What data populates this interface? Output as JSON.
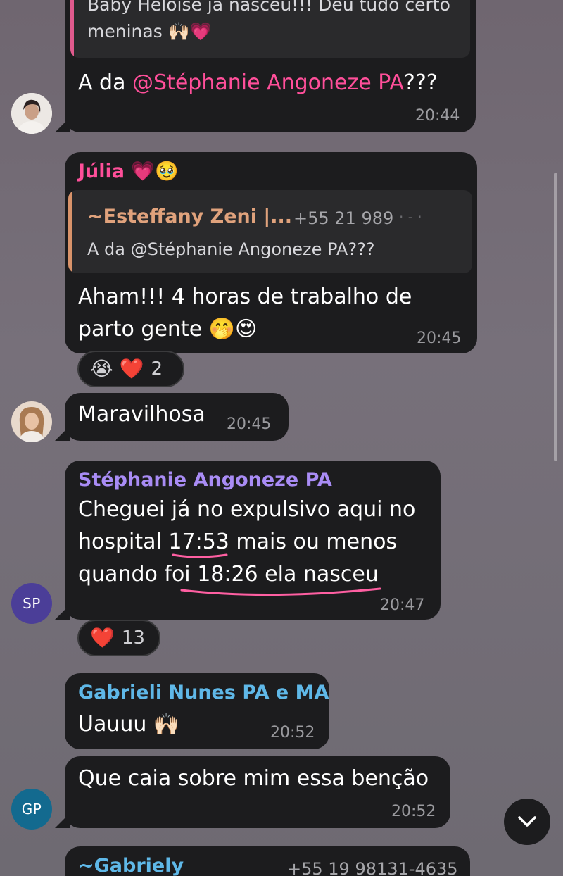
{
  "colors": {
    "bubble": "#1c1c1e",
    "julia": "#ff4f9a",
    "mention": "#ff4f9a",
    "stephanie": "#a98cf5",
    "gabrieli": "#5fb8e8",
    "gabriely": "#5fb8e8",
    "quote_bar_orange": "#d9936a",
    "quote_bar_pink": "#e05a8d",
    "underline": "#ff5fa2",
    "avatar_sp": "#4b3e98",
    "avatar_gp": "#136a8f"
  },
  "messages": {
    "m1": {
      "quote_line1": "Baby Heloise já nasceu!!! Deu tudo certo",
      "quote_line2": "meninas 🙌🏻💗",
      "text_prefix": "A da ",
      "mention": "@Stéphanie Angoneze PA",
      "text_suffix": "???",
      "time": "20:44",
      "avatar_icon": "woman-avatar-photo"
    },
    "m2": {
      "sender": "Júlia 💗🥹",
      "quote_author": "~Esteffany Zeni |...",
      "quote_phone": "+55 21 989",
      "quote_phone_mask": "· - ·",
      "quote_text": "A da @Stéphanie Angoneze PA???",
      "line1": "Aham!!! 4 horas de trabalho de",
      "line2": "parto gente 🤭😍",
      "time": "20:45",
      "reaction_emojis": "😭 ❤️",
      "reaction_count": "2"
    },
    "m3": {
      "text": "Maravilhosa",
      "time": "20:45",
      "avatar_icon": "woman-avatar-photo"
    },
    "m4": {
      "sender": "Stéphanie Angoneze PA",
      "line1": "Cheguei já no expulsivo aqui no",
      "line2_a": "hospital ",
      "line2_b": "17:53",
      "line2_c": " mais ou menos",
      "line3_a": "quando foi ",
      "line3_b": "18:26 ela nasceu",
      "time": "20:47",
      "avatar_initials": "SP",
      "reaction_emoji": "❤️",
      "reaction_count": "13"
    },
    "m5": {
      "sender": "Gabrieli Nunes PA e MA",
      "text": "Uauuu 🙌🏻",
      "time": "20:52"
    },
    "m6": {
      "text": "Que caia sobre mim essa benção",
      "time": "20:52",
      "avatar_initials": "GP"
    },
    "m7": {
      "sender": "~Gabriely",
      "phone": "+55 19 98131-4635"
    }
  },
  "scroll_button_icon": "chevron-down-icon"
}
